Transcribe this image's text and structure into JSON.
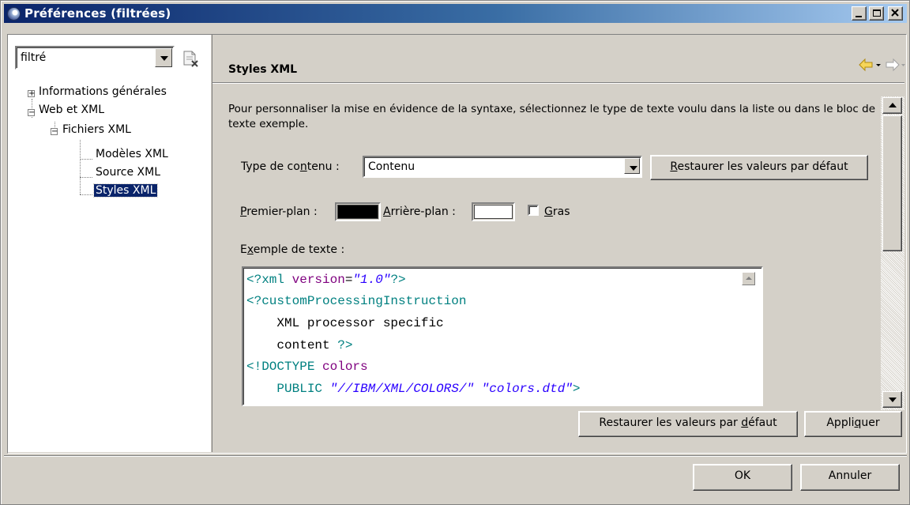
{
  "window": {
    "title": "Préférences (filtrées)"
  },
  "filter": {
    "value": "filtré"
  },
  "tree": {
    "items": [
      {
        "label": "Informations générales",
        "expander": "+"
      },
      {
        "label": "Web et XML",
        "expander": "−"
      },
      {
        "label": "Fichiers XML",
        "expander": "−"
      },
      {
        "label": "Modèles XML"
      },
      {
        "label": "Source XML"
      },
      {
        "label": "Styles XML",
        "selected": true
      }
    ]
  },
  "page": {
    "title": "Styles XML",
    "description": "Pour personnaliser la mise en évidence de la syntaxe, sélectionnez le type de texte voulu dans la liste ou dans le bloc de texte exemple.",
    "content_type": {
      "label_pre": "Type de co",
      "label_u": "n",
      "label_post": "tenu :",
      "value": "Contenu"
    },
    "restore_top": {
      "label_u": "R",
      "label_post": "estaurer les valeurs par défaut"
    },
    "foreground": {
      "label_u": "P",
      "label_post": "remier-plan :",
      "color": "#000000"
    },
    "background": {
      "label_u": "A",
      "label_post": "rrière-plan :",
      "color": "#ffffff"
    },
    "bold": {
      "label_u": "G",
      "label_post": "ras",
      "checked": false
    },
    "sample": {
      "label_pre": "E",
      "label_u": "x",
      "label_post": "emple de texte :"
    },
    "code": {
      "l1_a": "<?xml ",
      "l1_b": "version",
      "l1_c": "=",
      "l1_d": "\"1.0\"",
      "l1_e": "?>",
      "l2": "<?customProcessingInstruction",
      "l3": "    XML processor specific",
      "l4_a": "    content ",
      "l4_b": "?>",
      "l5_a": "<!DOCTYPE ",
      "l5_b": "colors",
      "l6_a": "    PUBLIC ",
      "l6_b": "\"//IBM/XML/COLORS/\"",
      "l6_c": " ",
      "l6_d": "\"colors.dtd\"",
      "l6_e": ">"
    },
    "restore_bottom": {
      "label_pre": "Restaurer les valeurs par ",
      "label_u": "d",
      "label_post": "éfaut"
    },
    "apply": {
      "label_pre": "Appli",
      "label_u": "q",
      "label_post": "uer"
    }
  },
  "footer": {
    "ok_label": "OK",
    "cancel_label": "Annuler"
  }
}
